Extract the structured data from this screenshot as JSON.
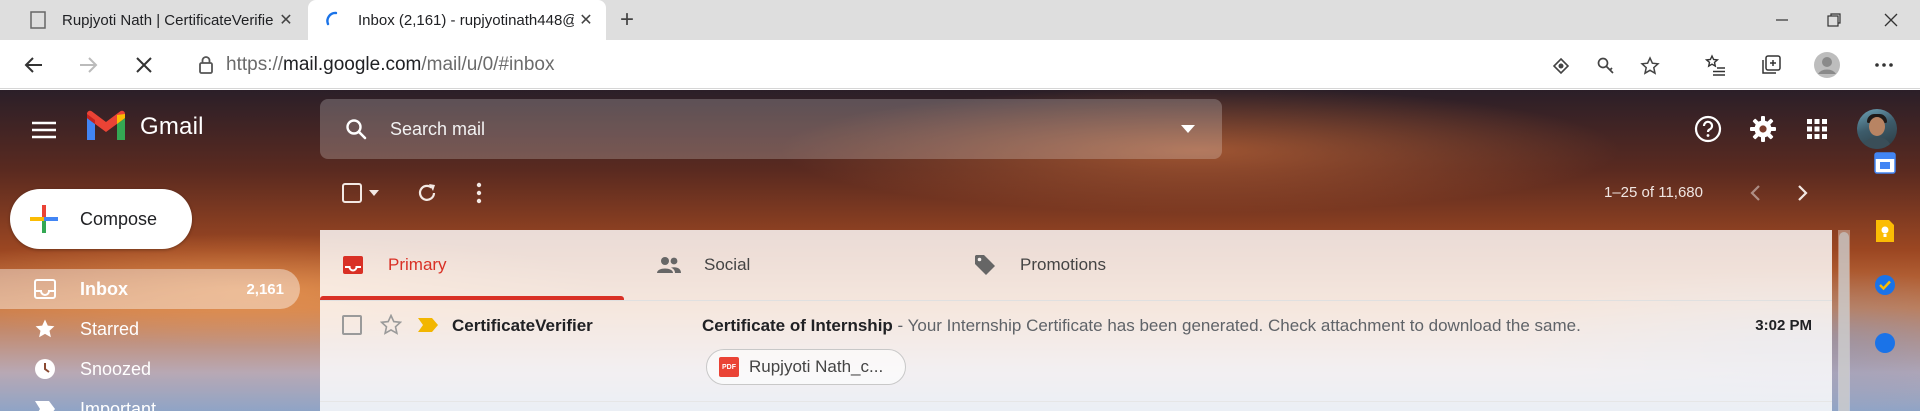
{
  "browser": {
    "tabs": [
      {
        "title": "Rupjyoti Nath | CertificateVerifier",
        "active": false
      },
      {
        "title": "Inbox (2,161) - rupjyotinath448@",
        "active": true
      }
    ],
    "url": {
      "scheme": "https://",
      "host": "mail.google.com",
      "path": "/mail/u/0/#inbox"
    }
  },
  "gmail": {
    "wordmark": "Gmail",
    "search": {
      "placeholder": "Search mail"
    },
    "compose_label": "Compose",
    "nav": [
      {
        "label": "Inbox",
        "count": "2,161",
        "icon": "inbox-icon"
      },
      {
        "label": "Starred",
        "count": "",
        "icon": "star-icon"
      },
      {
        "label": "Snoozed",
        "count": "",
        "icon": "clock-icon"
      },
      {
        "label": "Important",
        "count": "",
        "icon": "label-important-icon"
      }
    ],
    "pagination": "1–25 of 11,680",
    "categories": [
      {
        "label": "Primary",
        "icon": "inbox-icon",
        "selected": true
      },
      {
        "label": "Social",
        "icon": "people-icon",
        "selected": false
      },
      {
        "label": "Promotions",
        "icon": "tag-icon",
        "selected": false
      }
    ],
    "emails": [
      {
        "sender": "CertificateVerifier",
        "subject": "Certificate of Internship",
        "snippet": " - Your Internship Certificate has been generated. Check attachment to download the same.",
        "time": "3:02 PM",
        "attachment": "Rupjyoti Nath_c..."
      }
    ]
  },
  "colors": {
    "primary_tab": "#d93025",
    "compose_bg": "#ffffff",
    "important_marker": "#f2b600"
  }
}
